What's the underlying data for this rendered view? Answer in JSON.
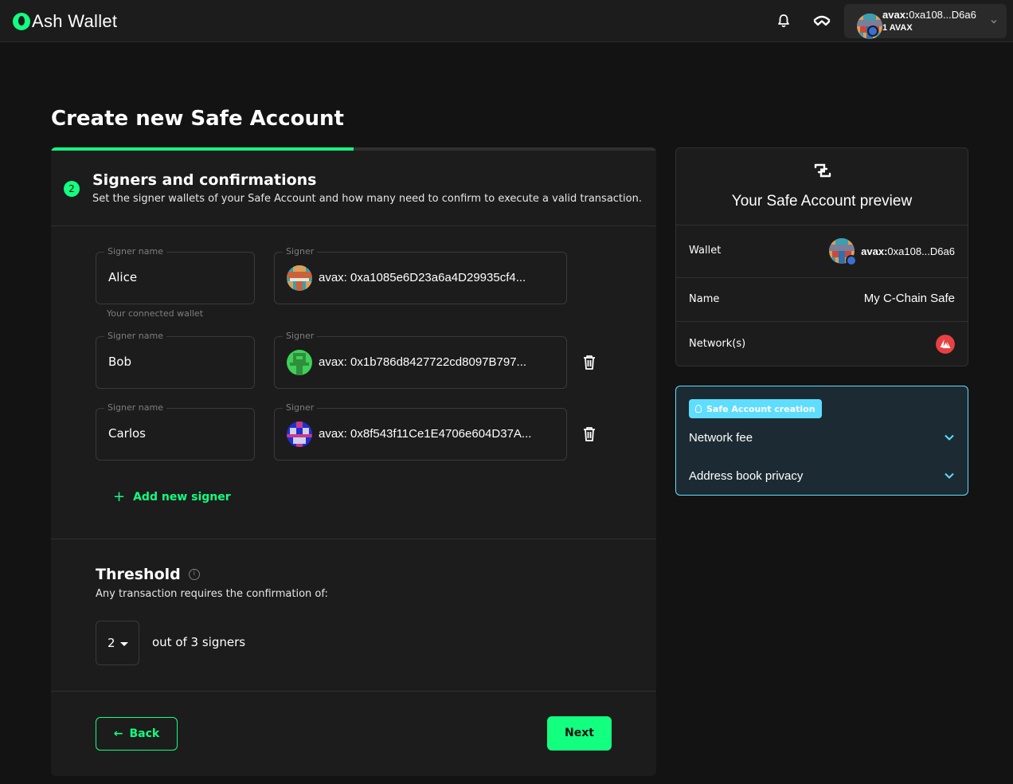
{
  "header": {
    "brand": "Ash Wallet",
    "account": {
      "prefix": "avax:",
      "address": "0xa108...D6a6",
      "balance": "1 AVAX"
    }
  },
  "page": {
    "title": "Create new Safe Account",
    "progress": 0.5,
    "step": {
      "number": "2",
      "title": "Signers and confirmations",
      "subtitle": "Set the signer wallets of your Safe Account and how many need to confirm to execute a valid transaction."
    },
    "signers": [
      {
        "name_label": "Signer name",
        "name": "Alice",
        "addr_label": "Signer",
        "address": "avax: 0xa1085e6D23a6a4D29935cf4...",
        "helper": "Your connected wallet"
      },
      {
        "name_label": "Signer name",
        "name": "Bob",
        "addr_label": "Signer",
        "address": "avax: 0x1b786d8427722cd8097B797..."
      },
      {
        "name_label": "Signer name",
        "name": "Carlos",
        "addr_label": "Signer",
        "address": "avax: 0x8f543f11Ce1E4706e604D37A..."
      }
    ],
    "add_signer": "Add new signer",
    "threshold": {
      "title": "Threshold",
      "subtitle": "Any transaction requires the confirmation of:",
      "value": "2",
      "out_of": "out of 3 signers"
    },
    "back": "Back",
    "next": "Next"
  },
  "preview": {
    "title": "Your Safe Account preview",
    "rows": {
      "wallet_label": "Wallet",
      "wallet_prefix": "avax:",
      "wallet_address": "0xa108...D6a6",
      "name_label": "Name",
      "name_value": "My C-Chain Safe",
      "network_label": "Network(s)"
    }
  },
  "info": {
    "tag": "Safe Account creation",
    "items": [
      "Network fee",
      "Address book privacy"
    ]
  },
  "colors": {
    "accent": "#12ff80",
    "info": "#5fddff",
    "avalanche": "#e84142",
    "background": "#121312",
    "panel": "#1c1c1c"
  }
}
